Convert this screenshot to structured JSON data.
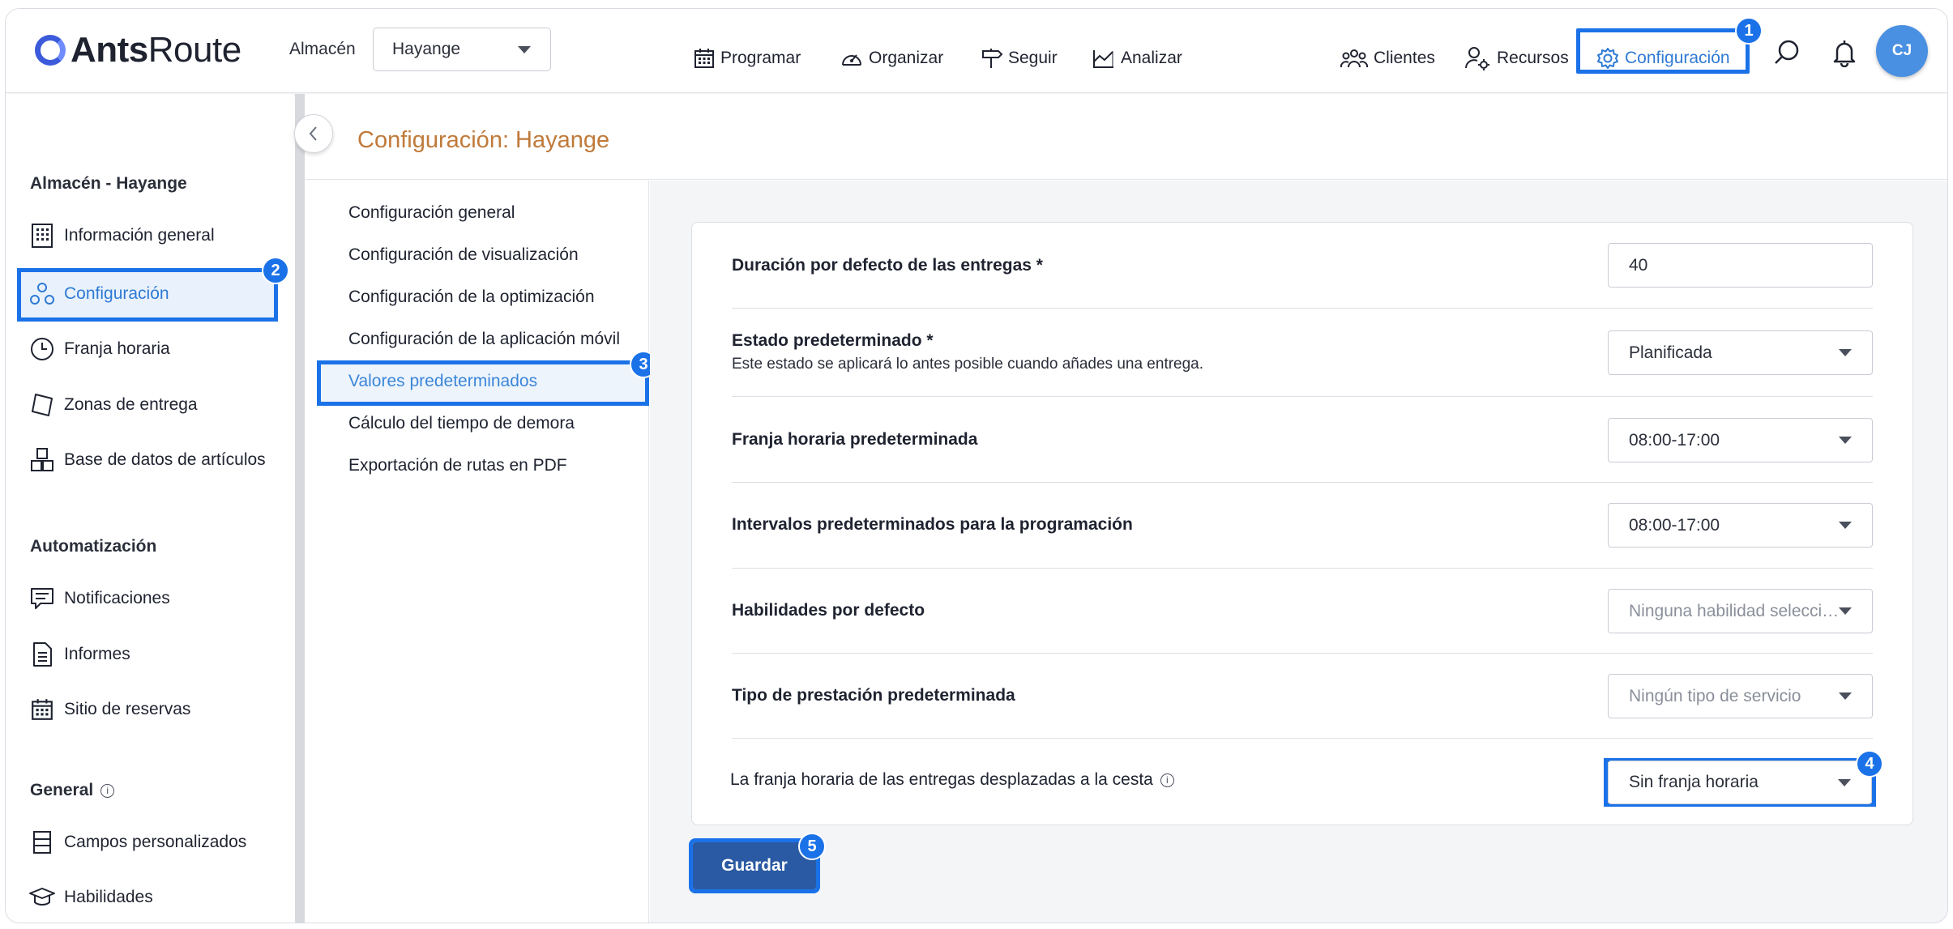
{
  "app": {
    "logo_bold": "Ants",
    "logo_light": "Route"
  },
  "warehouse": {
    "label": "Almacén",
    "value": "Hayange"
  },
  "topnav": {
    "programar": "Programar",
    "organizar": "Organizar",
    "seguir": "Seguir",
    "analizar": "Analizar",
    "clientes": "Clientes",
    "recursos": "Recursos",
    "configuracion": "Configuración"
  },
  "user": {
    "initials": "CJ"
  },
  "sidebar": {
    "section1": "Almacén - Hayange",
    "section2": "Automatización",
    "section3": "General",
    "items": {
      "info": "Información general",
      "config": "Configuración",
      "franja": "Franja horaria",
      "zonas": "Zonas de entrega",
      "base": "Base de datos de artículos",
      "notif": "Notificaciones",
      "informes": "Informes",
      "sitio": "Sitio de reservas",
      "campos": "Campos personalizados",
      "habilidades": "Habilidades"
    }
  },
  "page": {
    "title": "Configuración: Hayange"
  },
  "subnav": {
    "general": "Configuración general",
    "visual": "Configuración de visualización",
    "optim": "Configuración de la optimización",
    "movil": "Configuración de la aplicación móvil",
    "valores": "Valores predeterminados",
    "calculo": "Cálculo del tiempo de demora",
    "export": "Exportación de rutas en PDF"
  },
  "form": {
    "duracion": {
      "label": "Duración por defecto de las entregas *",
      "value": "40"
    },
    "estado": {
      "label": "Estado predeterminado *",
      "sub": "Este estado se aplicará lo antes posible cuando añades una entrega.",
      "value": "Planificada"
    },
    "franja": {
      "label": "Franja horaria predeterminada",
      "value": "08:00-17:00"
    },
    "intervalos": {
      "label": "Intervalos predeterminados para la programación",
      "value": "08:00-17:00"
    },
    "habilidades": {
      "label": "Habilidades por defecto",
      "placeholder": "Ninguna habilidad seleccionada"
    },
    "tipo": {
      "label": "Tipo de prestación predeterminada",
      "placeholder": "Ningún tipo de servicio"
    },
    "cesta": {
      "label": "La franja horaria de las entregas desplazadas a la cesta",
      "value": "Sin franja horaria"
    }
  },
  "buttons": {
    "save": "Guardar"
  },
  "badges": {
    "b1": "1",
    "b2": "2",
    "b3": "3",
    "b4": "4",
    "b5": "5"
  },
  "colors": {
    "highlight": "#1b72e8",
    "accent_title": "#c07a3a",
    "save_bg": "#2a5aa3",
    "avatar": "#4a90e2"
  }
}
